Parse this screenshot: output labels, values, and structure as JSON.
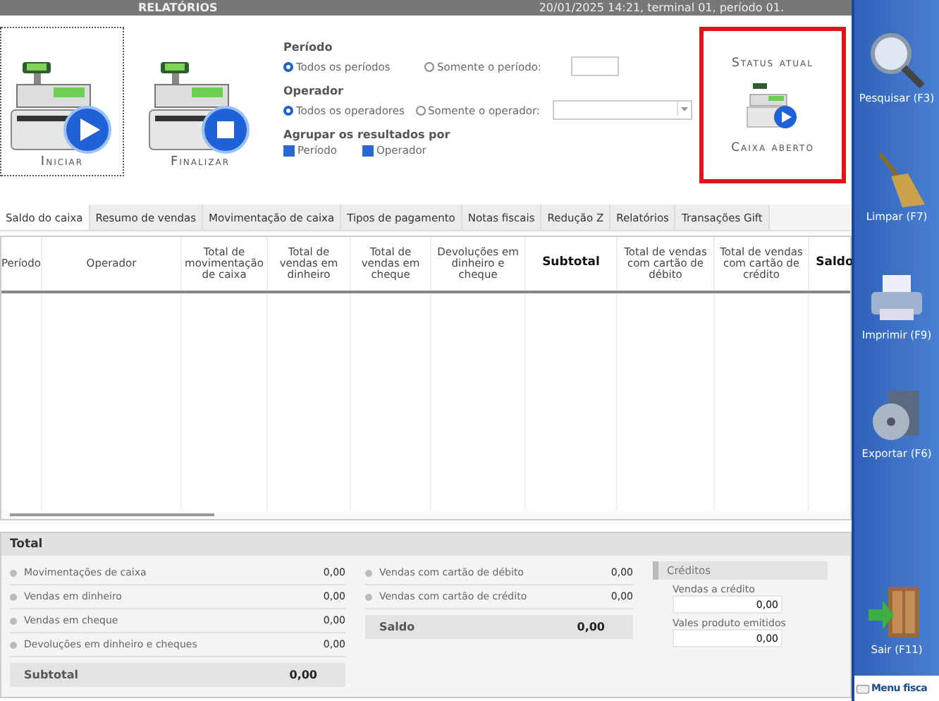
{
  "title_bar": {
    "title": "RELATÓRIOS",
    "info": "20/01/2025 14:21, terminal 01, período 01."
  },
  "actions": [
    {
      "label": "Iniciar",
      "kind": "play",
      "focused": true
    },
    {
      "label": "Finalizar",
      "kind": "stop",
      "focused": false
    }
  ],
  "filters": [
    {
      "label": "Período",
      "options": [
        {
          "label": "Todos os períodos",
          "selected": true
        },
        {
          "label": "Somente o período:",
          "selected": false
        }
      ]
    },
    {
      "label": "Operador",
      "options": [
        {
          "label": "Todos os operadores",
          "selected": true
        },
        {
          "label": "Somente o operador:",
          "selected": false
        }
      ]
    }
  ],
  "group_by": {
    "label": "Agrupar os resultados por",
    "options": [
      {
        "label": "Período",
        "checked": true
      },
      {
        "label": "Operador",
        "checked": true
      }
    ]
  },
  "status": {
    "title": "Status atual",
    "value": "Caixa aberto"
  },
  "tabs": [
    {
      "label": "Saldo do caixa",
      "selected": true
    },
    {
      "label": "Resumo de vendas",
      "selected": false
    },
    {
      "label": "Movimentação de caixa",
      "selected": false
    },
    {
      "label": "Tipos de pagamento",
      "selected": false
    },
    {
      "label": "Notas fiscais",
      "selected": false
    },
    {
      "label": "Redução Z",
      "selected": false
    },
    {
      "label": "Relatórios",
      "selected": false
    },
    {
      "label": "Transações Gift",
      "selected": false
    }
  ],
  "table": {
    "columns": [
      {
        "label": "Período",
        "bold": false
      },
      {
        "label": "Operador",
        "bold": false
      },
      {
        "label": "Total de movimentação de caixa",
        "bold": false
      },
      {
        "label": "Total de vendas em dinheiro",
        "bold": false
      },
      {
        "label": "Total de vendas em cheque",
        "bold": false
      },
      {
        "label": "Devoluções em dinheiro e cheque",
        "bold": false
      },
      {
        "label": "Subtotal",
        "bold": true
      },
      {
        "label": "Total de vendas com cartão de débito",
        "bold": false
      },
      {
        "label": "Total de vendas com cartão de crédito",
        "bold": false
      },
      {
        "label": "Saldo",
        "bold": true
      }
    ]
  },
  "totals": {
    "title": "Total",
    "left": [
      {
        "label": "Movimentações de caixa",
        "value": "0,00"
      },
      {
        "label": "Vendas em dinheiro",
        "value": "0,00"
      },
      {
        "label": "Vendas em cheque",
        "value": "0,00"
      },
      {
        "label": "Devoluções em dinheiro e cheques",
        "value": "0,00"
      }
    ],
    "subtotal": {
      "label": "Subtotal",
      "value": "0,00"
    },
    "right": [
      {
        "label": "Vendas com cartão de débito",
        "value": "0,00"
      },
      {
        "label": "Vendas com cartão de crédito",
        "value": "0,00"
      }
    ],
    "saldo": {
      "label": "Saldo",
      "value": "0,00"
    },
    "credits": {
      "title": "Créditos",
      "fields": [
        {
          "label": "Vendas a crédito",
          "value": "0,00"
        },
        {
          "label": "Vales produto emitidos",
          "value": "0,00"
        }
      ]
    }
  },
  "sidebar": {
    "items": [
      {
        "label": "Pesquisar (F3)"
      },
      {
        "label": "Limpar (F7)"
      },
      {
        "label": "Imprimir (F9)"
      },
      {
        "label": "Exportar (F6)"
      },
      {
        "label": "Sair (F11)"
      }
    ],
    "footer": "Menu fisca"
  }
}
